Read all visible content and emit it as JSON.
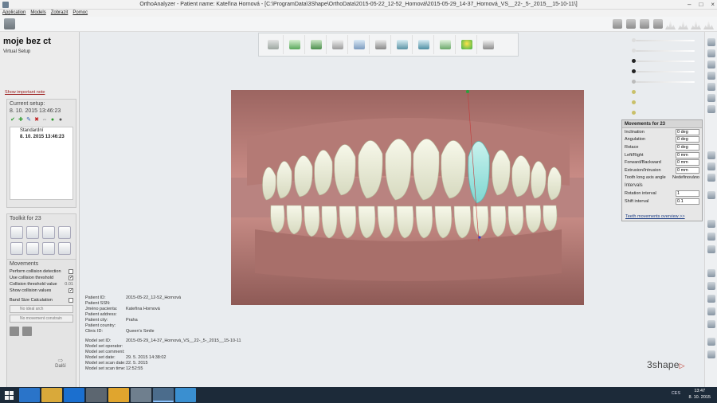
{
  "window": {
    "title": "OrthoAnalyzer - Patient name: Kateřina Hornová - [C:\\ProgramData\\3Shape\\OrthoData\\2015-05-22_12-52_Hornová\\2015-05-29_14-37_Hornová_VS__22-_5-_2015__15-10-11\\]",
    "minimize_glyph": "–",
    "maximize_glyph": "□",
    "close_glyph": "×"
  },
  "menu": [
    "Application",
    "Models",
    "Zobrazit",
    "Pomoc"
  ],
  "left": {
    "project_name": "moje bez ct",
    "project_subtitle": "Virtual Setup",
    "important_note_link": "Show important note",
    "current_setup_title": "Current setup:",
    "current_setup_date": "8. 10. 2015  13:46:23",
    "setups": [
      "Standardní",
      "8. 10. 2015  13:46:23"
    ],
    "toolkit_title": "Toolkit for 23",
    "movements_title": "Movements",
    "options": [
      {
        "label": "Perform collision detection",
        "checked": false
      },
      {
        "label": "Use collision threshold",
        "checked": true
      }
    ],
    "threshold_label": "Collision threshold value",
    "threshold_value": "0.01",
    "show_collision_label": "Show collision values",
    "show_collision_checked": true,
    "band_size_label": "Band Size Calculation",
    "band_size_checked": false,
    "ideal_arch_placeholder": "No ideal arch",
    "movement_constraint_placeholder": "No movement constrain",
    "next_label": "Další",
    "next_arrow": "⇨"
  },
  "movements_panel": {
    "title": "Movements for 23",
    "rows": [
      {
        "label": "Inclination",
        "value": "0 deg"
      },
      {
        "label": "Angulation",
        "value": "0 deg"
      },
      {
        "label": "Rotace",
        "value": "0 deg"
      },
      {
        "label": "Left/Right",
        "value": "0 mm"
      },
      {
        "label": "Forward/Backward",
        "value": "0 mm"
      },
      {
        "label": "Extrusion/Intrusion",
        "value": "0 mm"
      }
    ],
    "axis_label": "Tooth long axis angle",
    "axis_value": "Nedefinováno",
    "intervals_label": "Intervals",
    "rotation_interval_label": "Rotation interval",
    "rotation_interval_value": "1",
    "shift_interval_label": "Shift interval",
    "shift_interval_value": "0.1",
    "overview_link": "Teeth movements overview >>"
  },
  "patient_info": [
    {
      "k": "Patient ID:",
      "v": "2015-05-22_12-52_Hornová"
    },
    {
      "k": "Patient SSN:",
      "v": ""
    },
    {
      "k": "Jméno pacienta:",
      "v": "Kateřina Hornová"
    },
    {
      "k": "Patient address:",
      "v": ""
    },
    {
      "k": "Patient city:",
      "v": "Praha"
    },
    {
      "k": "Patient country:",
      "v": ""
    },
    {
      "k": "Clinic ID:",
      "v": "Queen's Smile"
    }
  ],
  "model_info": [
    {
      "k": "Model set ID:",
      "v": "2015-05-29_14-37_Hornová_VS__22-_5-_2015__15-10-11"
    },
    {
      "k": "Model set operator:",
      "v": ""
    },
    {
      "k": "Model set comment:",
      "v": ""
    },
    {
      "k": "Model set date:",
      "v": "29. 5. 2015 14:38:02"
    },
    {
      "k": "Model set scan date:",
      "v": "22. 5. 2015"
    },
    {
      "k": "Model set scan time:",
      "v": "12:52:55"
    }
  ],
  "logo": {
    "text": "3shape",
    "mark": "▷"
  },
  "taskbar": {
    "tray_language": "CES",
    "time": "13:47",
    "date": "8. 10. 2015"
  },
  "colors": {
    "accent": "#1f3f85",
    "gum": "#b57a75",
    "tooth": "#eef0d8",
    "selected_tooth": "#9fe4e0",
    "taskbar": "#1c2a39"
  },
  "toolbar_icons": [
    "scan-icon",
    "axes-icon",
    "monitor-icon",
    "tooth-select-icon",
    "curve-icon",
    "segment-icon",
    "box-icon",
    "arch-icon",
    "setup-icon",
    "marker-icon",
    "printer-icon"
  ]
}
